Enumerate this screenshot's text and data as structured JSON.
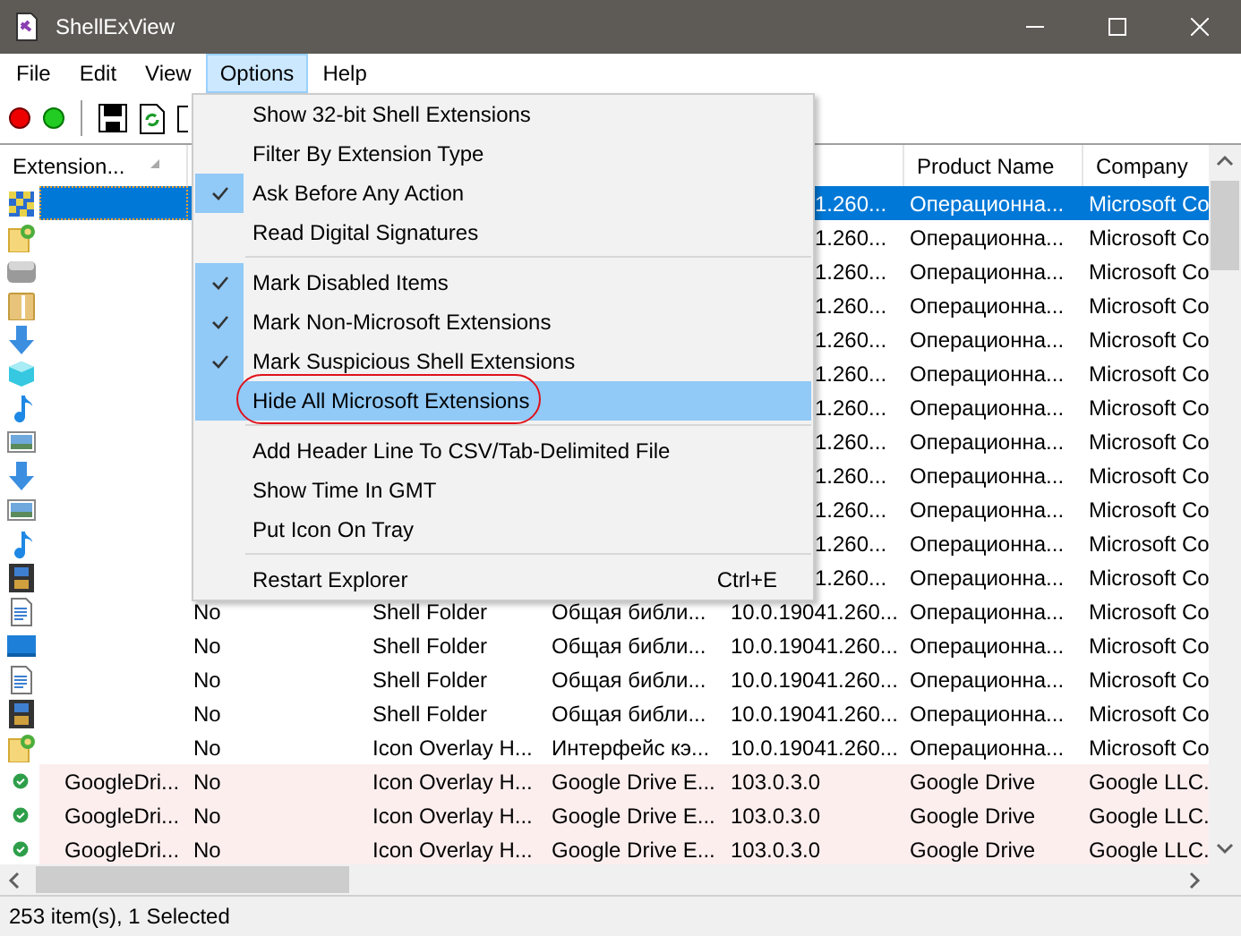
{
  "window": {
    "title": "ShellExView"
  },
  "menu_bar": [
    {
      "label": "File",
      "selected": false
    },
    {
      "label": "Edit",
      "selected": false
    },
    {
      "label": "View",
      "selected": false
    },
    {
      "label": "Options",
      "selected": true
    },
    {
      "label": "Help",
      "selected": false
    }
  ],
  "columns": {
    "extension": "Extension...",
    "product": "Product Name",
    "company": "Company"
  },
  "rows": [
    {
      "selected": true,
      "non_microsoft": false,
      "version": "1.260...",
      "product": "Операционна...",
      "company": "Microsoft Co"
    },
    {
      "selected": false,
      "non_microsoft": false,
      "version": "1.260...",
      "product": "Операционна...",
      "company": "Microsoft Co"
    },
    {
      "selected": false,
      "non_microsoft": false,
      "version": "1.260...",
      "product": "Операционна...",
      "company": "Microsoft Co"
    },
    {
      "selected": false,
      "non_microsoft": false,
      "version": "1.260...",
      "product": "Операционна...",
      "company": "Microsoft Co"
    },
    {
      "selected": false,
      "non_microsoft": false,
      "version": "1.260...",
      "product": "Операционна...",
      "company": "Microsoft Co"
    },
    {
      "selected": false,
      "non_microsoft": false,
      "version": "1.260...",
      "product": "Операционна...",
      "company": "Microsoft Co"
    },
    {
      "selected": false,
      "non_microsoft": false,
      "version": "1.260...",
      "product": "Операционна...",
      "company": "Microsoft Co"
    },
    {
      "selected": false,
      "non_microsoft": false,
      "version": "1.260...",
      "product": "Операционна...",
      "company": "Microsoft Co"
    },
    {
      "selected": false,
      "non_microsoft": false,
      "version": "1.260...",
      "product": "Операционна...",
      "company": "Microsoft Co"
    },
    {
      "selected": false,
      "non_microsoft": false,
      "version": "1.260...",
      "product": "Операционна...",
      "company": "Microsoft Co"
    },
    {
      "selected": false,
      "non_microsoft": false,
      "version": "1.260...",
      "product": "Операционна...",
      "company": "Microsoft Co"
    },
    {
      "selected": false,
      "non_microsoft": false,
      "version": "1.260...",
      "product": "Операционна...",
      "company": "Microsoft Co"
    },
    {
      "selected": false,
      "non_microsoft": false,
      "disabled": "No",
      "type": "Shell Folder",
      "description": "Общая библи...",
      "version": "10.0.19041.260...",
      "product": "Операционна...",
      "company": "Microsoft Co"
    },
    {
      "selected": false,
      "non_microsoft": false,
      "disabled": "No",
      "type": "Shell Folder",
      "description": "Общая библи...",
      "version": "10.0.19041.260...",
      "product": "Операционна...",
      "company": "Microsoft Co"
    },
    {
      "selected": false,
      "non_microsoft": false,
      "disabled": "No",
      "type": "Shell Folder",
      "description": "Общая библи...",
      "version": "10.0.19041.260...",
      "product": "Операционна...",
      "company": "Microsoft Co"
    },
    {
      "selected": false,
      "non_microsoft": false,
      "disabled": "No",
      "type": "Shell Folder",
      "description": "Общая библи...",
      "version": "10.0.19041.260...",
      "product": "Операционна...",
      "company": "Microsoft Co"
    },
    {
      "selected": false,
      "non_microsoft": false,
      "disabled": "No",
      "type": "Icon Overlay H...",
      "description": "Интерфейс кэ...",
      "version": "10.0.19041.260...",
      "product": "Операционна...",
      "company": "Microsoft Co"
    },
    {
      "selected": false,
      "non_microsoft": true,
      "name": "GoogleDri...",
      "disabled": "No",
      "type": "Icon Overlay H...",
      "description": "Google Drive E...",
      "version": "103.0.3.0",
      "product": "Google Drive",
      "company": "Google LLC."
    },
    {
      "selected": false,
      "non_microsoft": true,
      "name": "GoogleDri...",
      "disabled": "No",
      "type": "Icon Overlay H...",
      "description": "Google Drive E...",
      "version": "103.0.3.0",
      "product": "Google Drive",
      "company": "Google LLC."
    },
    {
      "selected": false,
      "non_microsoft": true,
      "name": "GoogleDri...",
      "disabled": "No",
      "type": "Icon Overlay H...",
      "description": "Google Drive E...",
      "version": "103.0.3.0",
      "product": "Google Drive",
      "company": "Google LLC."
    }
  ],
  "options_menu": [
    {
      "kind": "item",
      "label": "Show 32-bit Shell Extensions",
      "checked": false,
      "selected": false,
      "circled": false
    },
    {
      "kind": "item",
      "label": "Filter By Extension Type",
      "checked": false,
      "selected": false,
      "circled": false
    },
    {
      "kind": "item",
      "label": "Ask Before Any Action",
      "checked": true,
      "selected": false,
      "circled": false
    },
    {
      "kind": "item",
      "label": "Read Digital Signatures",
      "checked": false,
      "selected": false,
      "circled": false
    },
    {
      "kind": "separator"
    },
    {
      "kind": "item",
      "label": "Mark Disabled Items",
      "checked": true,
      "selected": false,
      "circled": false
    },
    {
      "kind": "item",
      "label": "Mark Non-Microsoft Extensions",
      "checked": true,
      "selected": false,
      "circled": false
    },
    {
      "kind": "item",
      "label": "Mark Suspicious Shell Extensions",
      "checked": true,
      "selected": false,
      "circled": false
    },
    {
      "kind": "item",
      "label": "Hide All Microsoft Extensions",
      "checked": false,
      "selected": true,
      "circled": true
    },
    {
      "kind": "separator"
    },
    {
      "kind": "item",
      "label": "Add Header Line To CSV/Tab-Delimited File",
      "checked": false,
      "selected": false,
      "circled": false
    },
    {
      "kind": "item",
      "label": "Show Time In GMT",
      "checked": false,
      "selected": false,
      "circled": false
    },
    {
      "kind": "item",
      "label": "Put Icon On Tray",
      "checked": false,
      "selected": false,
      "circled": false
    },
    {
      "kind": "separator"
    },
    {
      "kind": "item",
      "label": "Restart Explorer",
      "shortcut": "Ctrl+E",
      "checked": false,
      "selected": false,
      "circled": false
    }
  ],
  "status_bar": "253 item(s), 1 Selected"
}
